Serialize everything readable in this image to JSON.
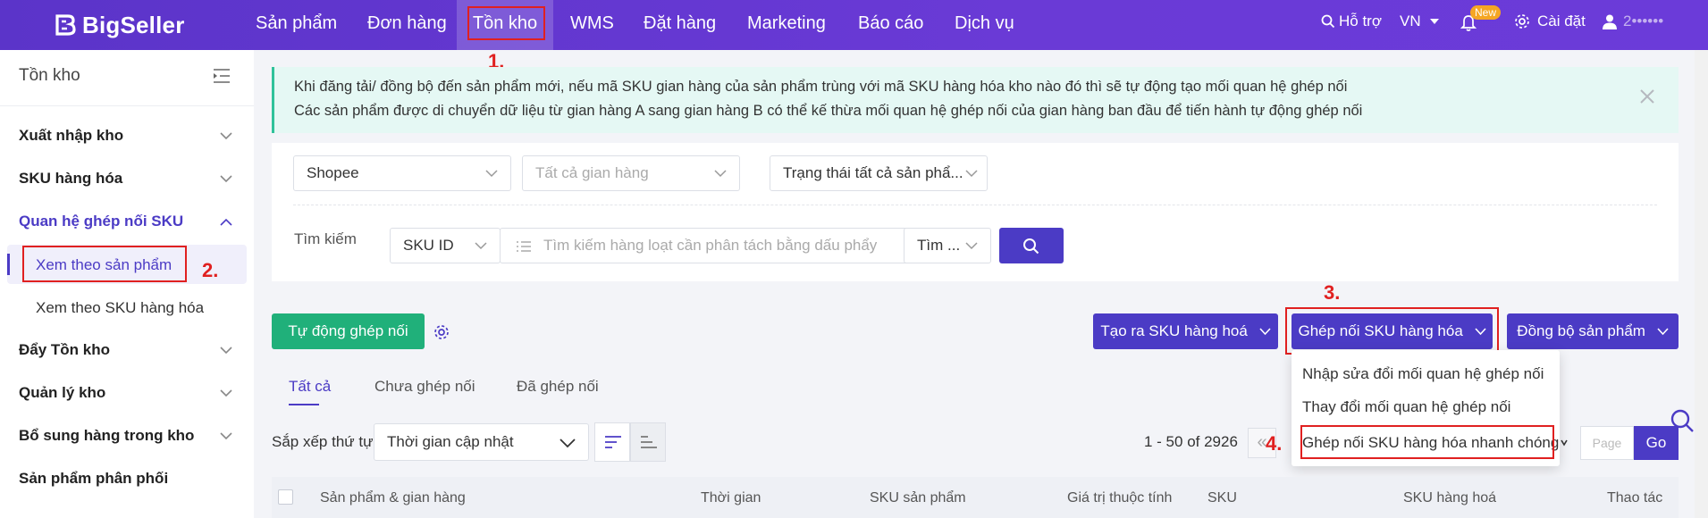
{
  "topnav": {
    "logo": "BigSeller",
    "items": [
      "Sản phẩm",
      "Đơn hàng",
      "Tồn kho",
      "WMS",
      "Đặt hàng",
      "Marketing",
      "Báo cáo",
      "Dịch vụ"
    ],
    "support": "Hỗ trợ",
    "language": "VN",
    "new_badge": "New",
    "settings": "Cài đặt",
    "user": "2••••••"
  },
  "sidebar": {
    "title": "Tồn kho",
    "items": [
      "Xuất nhập kho",
      "SKU hàng hóa",
      "Quan hệ ghép nối SKU",
      "Đẩy Tồn kho",
      "Quản lý kho",
      "Bổ sung hàng trong kho",
      "Sản phẩm phân phối"
    ],
    "sub_items": [
      "Xem theo sản phẩm",
      "Xem theo SKU hàng hóa"
    ]
  },
  "notice": {
    "line1": "Khi đăng tải/ đồng bộ đến sản phẩm mới, nếu mã SKU gian hàng của sản phẩm trùng với mã SKU hàng hóa kho nào đó thì sẽ tự động tạo mối quan hệ ghép nối",
    "line2": "Các sản phẩm được di chuyển dữ liệu từ gian hàng A sang gian hàng B có thể kế thừa mối quan hệ ghép nối của gian hàng ban đầu để tiến hành tự động ghép nối"
  },
  "filters": {
    "platform": "Shopee",
    "store": "Tất cả gian hàng",
    "status": "Trạng thái tất cả sản phẩ...",
    "search_label": "Tìm kiếm",
    "search_type": "SKU ID",
    "search_placeholder": "Tìm kiếm hàng loạt cần phân tách bằng dấu phẩy",
    "search_mode": "Tìm ..."
  },
  "toolbar": {
    "auto_match": "Tự động ghép nối",
    "create_sku": "Tạo ra SKU hàng hoá",
    "match_sku": "Ghép nối SKU hàng hóa",
    "sync_products": "Đồng bộ sản phẩm"
  },
  "dropdown": {
    "items": [
      "Nhập sửa đổi mối quan hệ ghép nối",
      "Thay đổi mối quan hệ ghép nối",
      "Ghép nối SKU hàng hóa nhanh chóng"
    ]
  },
  "tabs": [
    "Tất cả",
    "Chưa ghép nối",
    "Đã ghép nối"
  ],
  "sort": {
    "label": "Sắp xếp thứ tự",
    "value": "Thời gian cập nhật"
  },
  "pager": {
    "range": "1 - 50 of 2926",
    "prev": "«",
    "page_placeholder": "Page",
    "go": "Go"
  },
  "table": {
    "headers": [
      "Sản phẩm & gian hàng",
      "Thời gian",
      "SKU sản phẩm",
      "Giá trị thuộc tính",
      "SKU",
      "SKU hàng hoá",
      "Thao tác"
    ]
  },
  "steps": [
    "1.",
    "2.",
    "3.",
    "4."
  ],
  "colors": {
    "primary": "#4b3bc5",
    "green": "#20b07a",
    "annotation_red": "#e02020",
    "notice_bg": "#e5f8f4"
  }
}
